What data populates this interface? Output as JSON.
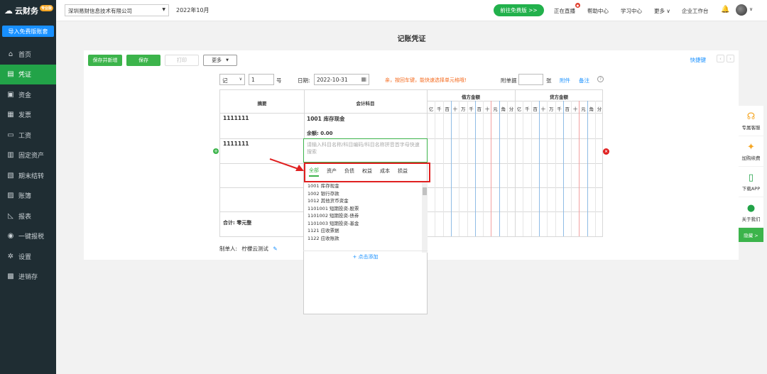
{
  "sidebar": {
    "logo": "云财务",
    "logo_badge": "专业版",
    "import_btn": "导入免费版账套",
    "items": [
      {
        "icon": "home-icon",
        "glyph": "⌂",
        "label": "首页"
      },
      {
        "icon": "voucher-icon",
        "glyph": "▤",
        "label": "凭证",
        "active": true
      },
      {
        "icon": "fund-icon",
        "glyph": "▣",
        "label": "资金"
      },
      {
        "icon": "invoice-icon",
        "glyph": "▦",
        "label": "发票"
      },
      {
        "icon": "salary-icon",
        "glyph": "▭",
        "label": "工资"
      },
      {
        "icon": "asset-icon",
        "glyph": "▥",
        "label": "固定资产"
      },
      {
        "icon": "period-end-icon",
        "glyph": "▧",
        "label": "期末结转"
      },
      {
        "icon": "ledger-icon",
        "glyph": "▨",
        "label": "账簿"
      },
      {
        "icon": "report-icon",
        "glyph": "◺",
        "label": "报表"
      },
      {
        "icon": "tax-icon",
        "glyph": "◉",
        "label": "一键报税"
      },
      {
        "icon": "settings-icon",
        "glyph": "✲",
        "label": "设置"
      },
      {
        "icon": "inventory-icon",
        "glyph": "▩",
        "label": "进销存"
      }
    ]
  },
  "topbar": {
    "company": "深圳易财信息技术有限公司",
    "period": "2022年10月",
    "free_btn": "前往免费版 >>",
    "live": "正在直播",
    "live_badge": "live",
    "help": "帮助中心",
    "learn": "学习中心",
    "more": "更多 ∨",
    "workbench": "企业工作台"
  },
  "page": {
    "title": "记账凭证"
  },
  "toolbar": {
    "save_new": "保存并新增",
    "save": "保存",
    "print": "打印",
    "more": "更多",
    "quick_keys": "快捷键"
  },
  "meta": {
    "voucher_type": "记",
    "voucher_no": "1",
    "no_label": "号",
    "date_label": "日期:",
    "date": "2022-10-31",
    "tip": "亲，按回车键，能快速选择单元格哦!",
    "attach_label": "附单据",
    "attach_unit": "张",
    "attachment": "附件",
    "remark": "备注",
    "help": "?"
  },
  "table": {
    "col_summary": "摘要",
    "col_account": "会计科目",
    "col_debit": "借方金额",
    "col_credit": "贷方金额",
    "units": [
      "亿",
      "千",
      "百",
      "十",
      "万",
      "千",
      "百",
      "十",
      "元",
      "角",
      "分"
    ],
    "row1_summary": "1111111",
    "row1_account": "1001 库存现金",
    "row1_balance": "余额: 0.00",
    "row2_summary": "1111111",
    "total_label": "合计: 零元整"
  },
  "dropdown": {
    "placeholder": "请输入科目名称/科目编码/科目名称拼音首字母快速搜索",
    "tabs": [
      "全部",
      "资产",
      "负债",
      "权益",
      "成本",
      "损益"
    ],
    "items": [
      "1001 库存现金",
      "1002 银行存款",
      "1012 其他货币资金",
      "1101001 短期投资-股票",
      "1101002 短期投资-债券",
      "1101003 短期投资-基金",
      "1121 应收票据",
      "1122 应收账款"
    ],
    "add_more": "+ 点击添加"
  },
  "maker": {
    "label": "制单人:",
    "name": "柠檬云测试"
  },
  "right_panel": {
    "items": [
      "专属客服",
      "加购续费",
      "下载APP",
      "关于我们"
    ],
    "hide": "隐藏 >"
  },
  "colors": {
    "accent": "#3cb44b",
    "sidebar_bg": "#1f2d33",
    "link": "#1890ff",
    "warning": "#f56b1f",
    "highlight": "#e02020"
  }
}
